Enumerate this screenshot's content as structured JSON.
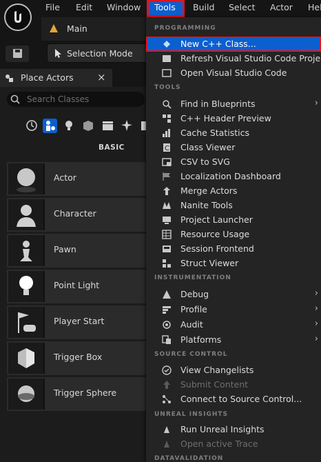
{
  "menubar": {
    "items": [
      "File",
      "Edit",
      "Window",
      "Tools",
      "Build",
      "Select",
      "Actor",
      "Help"
    ],
    "active": "Tools"
  },
  "tab": {
    "label": "Main"
  },
  "toolbar": {
    "selection_mode": "Selection Mode"
  },
  "panel": {
    "title": "Place Actors",
    "search_placeholder": "Search Classes",
    "category": "BASIC",
    "actors": [
      "Actor",
      "Character",
      "Pawn",
      "Point Light",
      "Player Start",
      "Trigger Box",
      "Trigger Sphere"
    ]
  },
  "dropdown": {
    "programming": {
      "title": "PROGRAMMING",
      "items": [
        "New C++ Class...",
        "Refresh Visual Studio Code Project",
        "Open Visual Studio Code"
      ]
    },
    "tools": {
      "title": "TOOLS",
      "items": [
        "Find in Blueprints",
        "C++ Header Preview",
        "Cache Statistics",
        "Class Viewer",
        "CSV to SVG",
        "Localization Dashboard",
        "Merge Actors",
        "Nanite Tools",
        "Project Launcher",
        "Resource Usage",
        "Session Frontend",
        "Struct Viewer"
      ]
    },
    "instrumentation": {
      "title": "INSTRUMENTATION",
      "items": [
        "Debug",
        "Profile",
        "Audit",
        "Platforms"
      ]
    },
    "source_control": {
      "title": "SOURCE CONTROL",
      "items": [
        "View Changelists",
        "Submit Content",
        "Connect to Source Control..."
      ]
    },
    "unreal_insights": {
      "title": "UNREAL INSIGHTS",
      "items": [
        "Run Unreal Insights",
        "Open active Trace"
      ]
    },
    "datavalidation": {
      "title": "DATAVALIDATION"
    }
  },
  "colors": {
    "accent": "#0b5fce",
    "highlight_border": "#e1141d"
  }
}
